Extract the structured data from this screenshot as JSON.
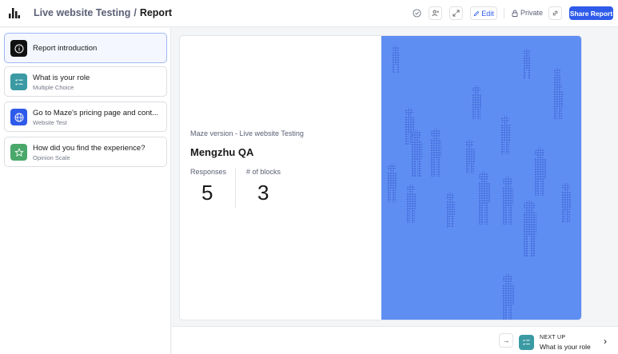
{
  "header": {
    "project_name": "Live website Testing",
    "separator": "/",
    "page_name": "Report",
    "edit_label": "Edit",
    "visibility_label": "Private",
    "share_label": "Share Report"
  },
  "sidebar": {
    "blocks": [
      {
        "title": "Report introduction",
        "subtitle": "",
        "icon": "info-icon",
        "color": "#111111"
      },
      {
        "title": "What is your role",
        "subtitle": "Multiple Choice",
        "icon": "checklist-icon",
        "color": "#3b9aa3"
      },
      {
        "title": "Go to Maze's pricing page and cont...",
        "subtitle": "Website Test",
        "icon": "globe-icon",
        "color": "#2f5bea"
      },
      {
        "title": "How did you find the experience?",
        "subtitle": "Opinion Scale",
        "icon": "star-icon",
        "color": "#4aa86a"
      }
    ]
  },
  "main": {
    "subtitle": "Maze version - Live website Testing",
    "maze_name": "Mengzhu QA",
    "stats": [
      {
        "label": "Responses",
        "value": "5"
      },
      {
        "label": "# of blocks",
        "value": "3"
      }
    ],
    "hero_color": "#5f8ef2"
  },
  "footer": {
    "next_up_label": "NEXT UP",
    "next_title": "What is your role"
  },
  "colors": {
    "accent": "#2f5bea"
  }
}
